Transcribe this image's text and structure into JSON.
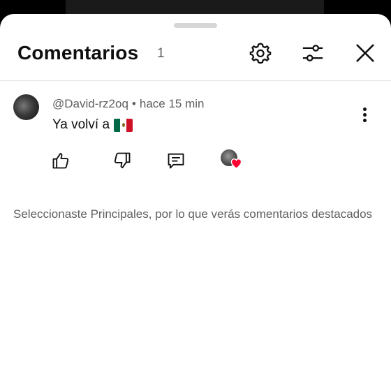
{
  "header": {
    "title": "Comentarios",
    "count": "1"
  },
  "comment": {
    "author": "@David-rz2oq",
    "separator": "•",
    "time": "hace 15 min",
    "text": "Ya volví a",
    "flag_icon": "mexico-flag-emoji"
  },
  "notice": "Seleccionaste Principales, por lo que verás comentarios destacados",
  "icons": {
    "settings": "gear-icon",
    "filter": "sliders-icon",
    "close": "close-icon",
    "more": "more-vert-icon",
    "like": "thumb-up-icon",
    "dislike": "thumb-down-icon",
    "reply": "comment-icon",
    "creator_heart": "heart-icon"
  },
  "colors": {
    "heart": "#ff0033",
    "secondary_text": "#606060",
    "primary_text": "#0f0f0f"
  }
}
